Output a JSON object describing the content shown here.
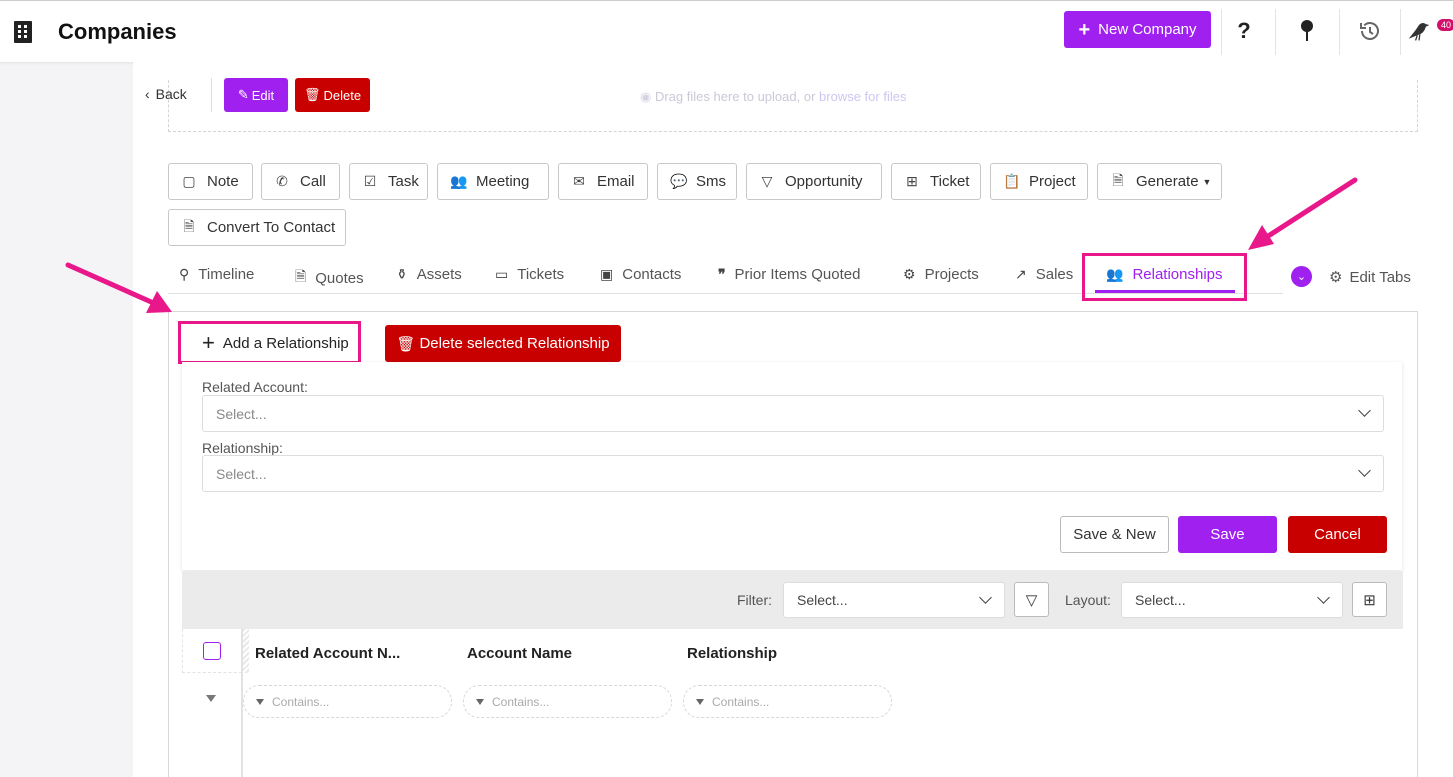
{
  "header": {
    "title": "Companies",
    "new_button": "New Company",
    "notification_count": "40"
  },
  "record_toolbar": {
    "back": "Back",
    "edit": "Edit",
    "delete": "Delete"
  },
  "upload": {
    "text": "Drag files here to upload, or",
    "link": "browse for files"
  },
  "actions": [
    {
      "label": "Note",
      "icon": "note-icon"
    },
    {
      "label": "Call",
      "icon": "phone-icon"
    },
    {
      "label": "Task",
      "icon": "clipboard-check-icon"
    },
    {
      "label": "Meeting",
      "icon": "users-icon"
    },
    {
      "label": "Email",
      "icon": "envelope-icon"
    },
    {
      "label": "Sms",
      "icon": "sms-icon"
    },
    {
      "label": "Opportunity",
      "icon": "funnel-icon"
    },
    {
      "label": "Ticket",
      "icon": "ticket-icon"
    },
    {
      "label": "Project",
      "icon": "clipboard-icon"
    },
    {
      "label": "Generate",
      "icon": "document-icon"
    },
    {
      "label": "Convert To Contact",
      "icon": "document-icon"
    }
  ],
  "tabs": [
    {
      "label": "Timeline",
      "icon": "timeline-icon"
    },
    {
      "label": "Quotes",
      "icon": "file-icon"
    },
    {
      "label": "Assets",
      "icon": "bag-icon"
    },
    {
      "label": "Tickets",
      "icon": "ticket-icon"
    },
    {
      "label": "Contacts",
      "icon": "id-card-icon"
    },
    {
      "label": "Prior Items Quoted",
      "icon": "quote-icon"
    },
    {
      "label": "Projects",
      "icon": "network-icon"
    },
    {
      "label": "Sales",
      "icon": "chart-line-icon"
    },
    {
      "label": "Relationships",
      "icon": "users-icon"
    }
  ],
  "active_tab": "Relationships",
  "edit_tabs": "Edit Tabs",
  "relationship": {
    "add_button": "Add a Relationship",
    "delete_button": "Delete selected Relationship",
    "related_account_label": "Related Account:",
    "related_account_placeholder": "Select...",
    "relationship_label": "Relationship:",
    "relationship_placeholder": "Select...",
    "save_new": "Save & New",
    "save": "Save",
    "cancel": "Cancel"
  },
  "grid": {
    "filter_label": "Filter:",
    "filter_placeholder": "Select...",
    "layout_label": "Layout:",
    "layout_placeholder": "Select...",
    "columns": [
      "Related Account N...",
      "Account Name",
      "Relationship"
    ],
    "filter_placeholder_text": "Contains..."
  },
  "colors": {
    "accent": "#a020f0",
    "danger": "#c80000",
    "annotation": "#e8178a"
  }
}
